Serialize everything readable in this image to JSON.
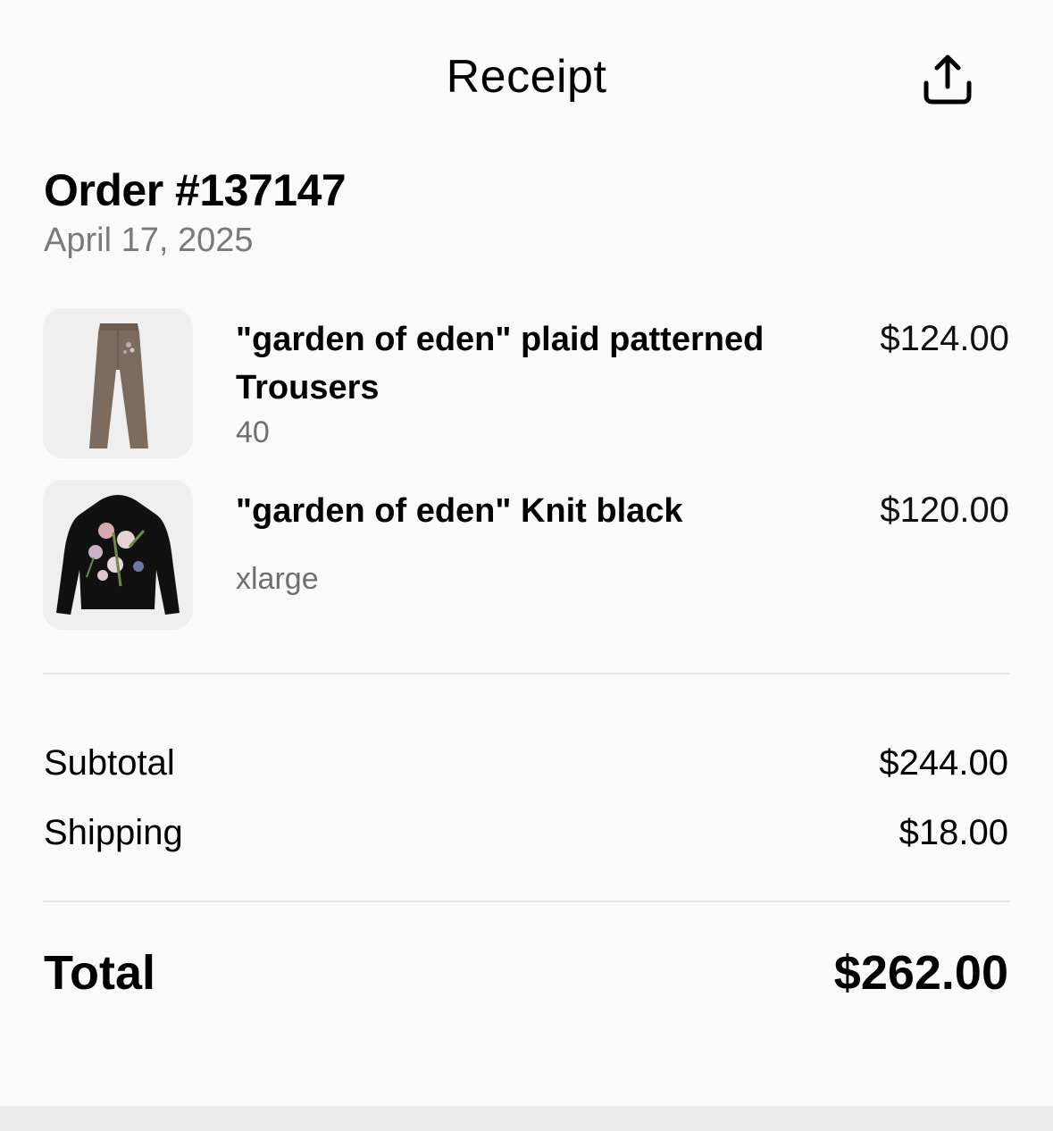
{
  "header": {
    "title": "Receipt",
    "share_icon": "share-icon"
  },
  "order": {
    "title": "Order #137147",
    "date": "April 17, 2025"
  },
  "items": [
    {
      "name": "\"garden of eden\" plaid patterned Trousers",
      "variant": "40",
      "price": "$124.00",
      "image_icon": "trousers-image"
    },
    {
      "name": "\"garden of eden\" Knit black",
      "variant": "xlarge",
      "price": "$120.00",
      "image_icon": "hoodie-image"
    }
  ],
  "summary": {
    "subtotal_label": "Subtotal",
    "subtotal_value": "$244.00",
    "shipping_label": "Shipping",
    "shipping_value": "$18.00",
    "total_label": "Total",
    "total_value": "$262.00"
  },
  "colors": {
    "background": "#fafafa",
    "secondary_text": "#7a7a7a",
    "divider": "#e6e6e6",
    "thumb_bg": "#efefef"
  }
}
